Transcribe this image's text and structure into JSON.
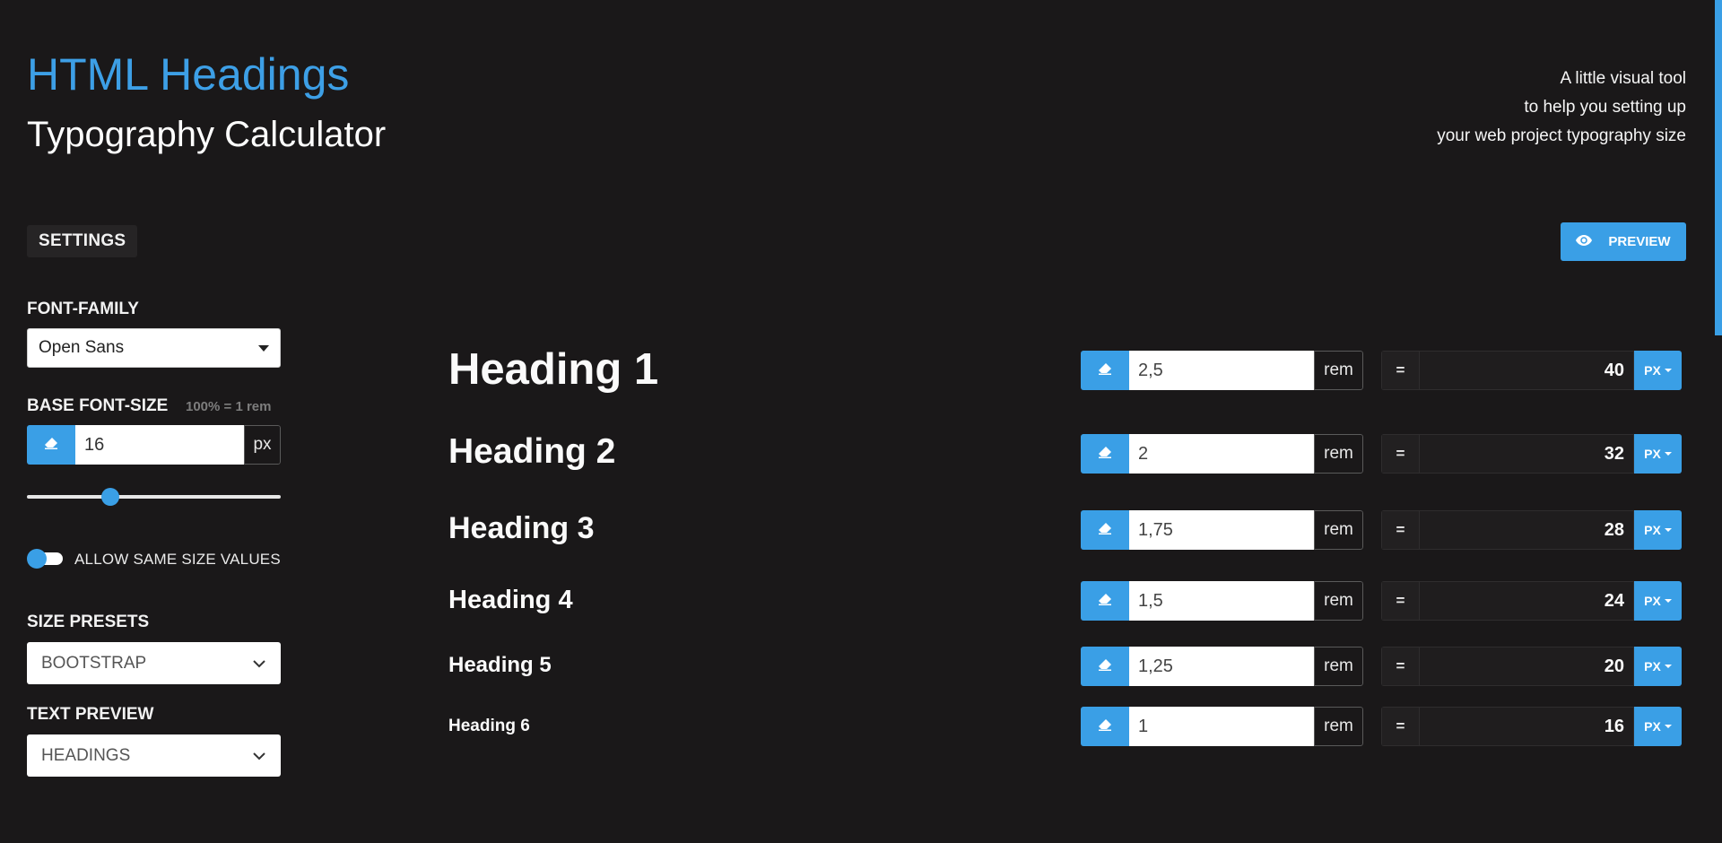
{
  "header": {
    "title_line1": "HTML Headings",
    "title_line2": "Typography Calculator",
    "tagline": [
      "A little visual tool",
      "to help you setting up",
      "your web project typography size"
    ]
  },
  "settings": {
    "badge": "SETTINGS",
    "font_family_label": "FONT-FAMILY",
    "font_family_value": "Open Sans",
    "base_font_size_label": "BASE FONT-SIZE",
    "base_font_size_note": "100% = 1 rem",
    "base_font_size_value": "16",
    "base_font_size_unit": "px",
    "slider_fraction": 0.33,
    "allow_same_size_label": "ALLOW SAME SIZE VALUES",
    "allow_same_size_on": false,
    "size_presets_label": "SIZE PRESETS",
    "size_presets_value": "BOOTSTRAP",
    "text_preview_label": "TEXT PREVIEW",
    "text_preview_value": "HEADINGS"
  },
  "preview_button": {
    "label": "PREVIEW",
    "icon": "eye-icon"
  },
  "headings": [
    {
      "label": "Heading 1",
      "rem": "2,5",
      "rem_unit": "rem",
      "eq": "=",
      "px": "40",
      "px_unit": "PX"
    },
    {
      "label": "Heading 2",
      "rem": "2",
      "rem_unit": "rem",
      "eq": "=",
      "px": "32",
      "px_unit": "PX"
    },
    {
      "label": "Heading 3",
      "rem": "1,75",
      "rem_unit": "rem",
      "eq": "=",
      "px": "28",
      "px_unit": "PX"
    },
    {
      "label": "Heading 4",
      "rem": "1,5",
      "rem_unit": "rem",
      "eq": "=",
      "px": "24",
      "px_unit": "PX"
    },
    {
      "label": "Heading 5",
      "rem": "1,25",
      "rem_unit": "rem",
      "eq": "=",
      "px": "20",
      "px_unit": "PX"
    },
    {
      "label": "Heading 6",
      "rem": "1",
      "rem_unit": "rem",
      "eq": "=",
      "px": "16",
      "px_unit": "PX"
    }
  ],
  "colors": {
    "accent": "#3a9fe6",
    "background": "#1a1819"
  }
}
